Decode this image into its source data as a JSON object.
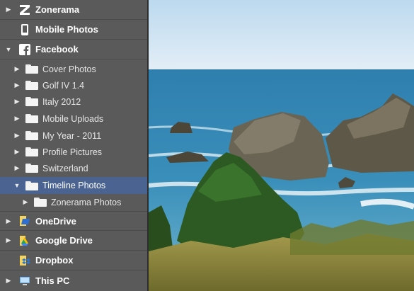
{
  "sidebar": {
    "top_items": [
      {
        "label": "Zonerama",
        "icon": "zonerama-icon",
        "expanded": false
      },
      {
        "label": "Mobile Photos",
        "icon": "mobile-phone-icon",
        "expanded": false
      },
      {
        "label": "Facebook",
        "icon": "facebook-icon",
        "expanded": true
      }
    ],
    "facebook_folders": [
      {
        "label": "Cover Photos"
      },
      {
        "label": "Golf IV 1.4"
      },
      {
        "label": "Italy 2012"
      },
      {
        "label": "Mobile Uploads"
      },
      {
        "label": "My Year - 2011"
      },
      {
        "label": "Profile Pictures"
      },
      {
        "label": "Switzerland"
      },
      {
        "label": "Timeline Photos",
        "selected": true,
        "expanded": true
      },
      {
        "label": "Zonerama Photos"
      }
    ],
    "bottom_items": [
      {
        "label": "OneDrive",
        "icon": "onedrive-icon"
      },
      {
        "label": "Google Drive",
        "icon": "google-drive-icon"
      },
      {
        "label": "Dropbox",
        "icon": "dropbox-icon"
      },
      {
        "label": "This PC",
        "icon": "computer-icon"
      }
    ]
  },
  "colors": {
    "sidebar_bg": "#5a5a5a",
    "selected_bg": "#4a6391",
    "text": "#ffffff"
  },
  "preview": {
    "icon": "photo-icon"
  }
}
